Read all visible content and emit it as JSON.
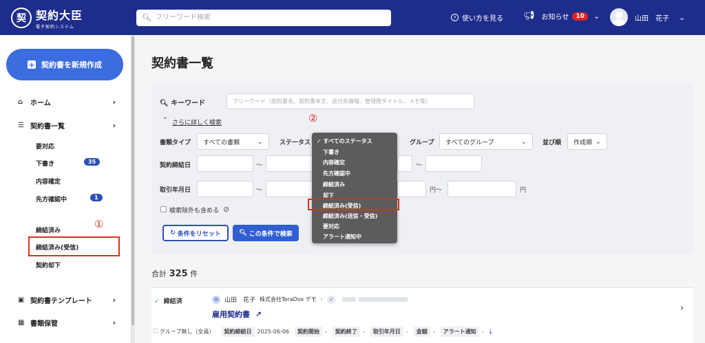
{
  "header": {
    "logo_mark": "契",
    "logo_title": "契約大臣",
    "logo_sub": "電子契約システム",
    "search_placeholder": "フリーワード検索",
    "help_label": "使い方を見る",
    "notice_label": "お知らせ",
    "notice_count": "10",
    "user_name": "山田　花子"
  },
  "sidebar": {
    "new_button": "契約書を新規作成",
    "home": "ホーム",
    "contracts": "契約書一覧",
    "sub": {
      "needs_action": "要対応",
      "draft": "下書き",
      "draft_count": "35",
      "content_confirmed": "内容確定",
      "awaiting_counterparty": "先方確認中",
      "awaiting_count": "1",
      "concluded": "締結済み",
      "concluded_received": "締結済み(受信)",
      "rejected": "契約却下"
    },
    "templates": "契約書テンプレート",
    "storage": "書類保管"
  },
  "annotations": {
    "one": "①",
    "two": "②"
  },
  "main": {
    "title": "契約書一覧",
    "keyword_label": "キーワード",
    "keyword_placeholder": "フリーワード（契約書名、契約書本文、送付先情報、管理用タイトル、メモ等）",
    "advanced_link": "さらに詳しく検索",
    "doc_type_label": "書類タイプ",
    "doc_type_value": "すべての書類",
    "status_label": "ステータス",
    "group_label": "グループ",
    "group_value": "すべてのグループ",
    "sort_label": "並び順",
    "sort_value": "作成順",
    "conclusion_date_label": "契約締結日",
    "transaction_date_label": "取引年月日",
    "tilde": "〜",
    "yen": "円",
    "yen_tilde": "円〜",
    "exclude_label": "検索除外も含める",
    "reset_button": "条件をリセット",
    "search_button": "この条件で検索"
  },
  "status_dropdown": {
    "items": [
      "すべてのステータス",
      "下書き",
      "内容確定",
      "先方確認中",
      "締結済み",
      "却下",
      "締結済み(受信)",
      "締結済み(送信・受信)",
      "要対応",
      "アラート通知中"
    ],
    "selected_index": 0,
    "highlighted_index": 6
  },
  "results": {
    "total_prefix": "合計",
    "total_count": "325",
    "total_suffix": "件",
    "row": {
      "status": "締結済",
      "party_name": "山田　花子",
      "party_company": "株式会社TeraDox デモ",
      "title": "雇用契約書",
      "group": "グループ無し（全員）",
      "conclusion_date_tag": "契約締結日",
      "conclusion_date": "2025-06-06",
      "start_tag": "契約開始",
      "end_tag": "契約終了",
      "transaction_tag": "取引年月日",
      "amount_tag": "金額",
      "alert_tag": "アラート通知",
      "dash": "-"
    }
  },
  "colors": {
    "header_bg": "#1e2d8c",
    "primary_button": "#3b6ddf",
    "annotation_red": "#d9301f",
    "badge_red": "#e32127"
  }
}
